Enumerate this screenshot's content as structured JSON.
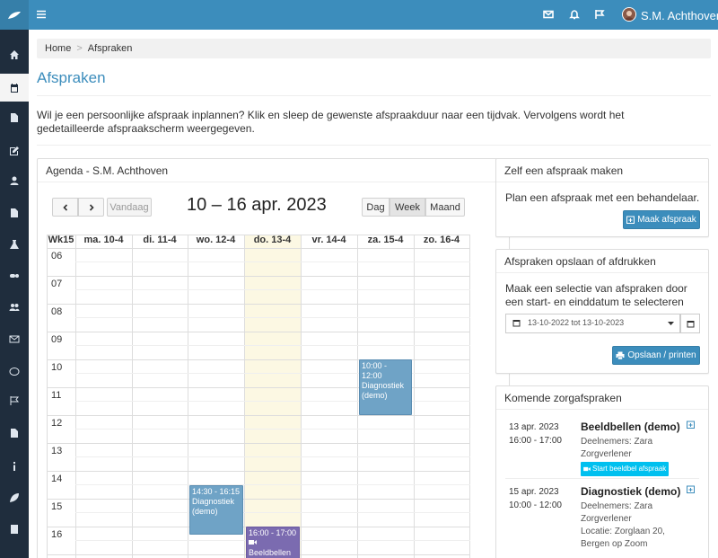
{
  "header": {
    "user_name": "S.M. Achthoven"
  },
  "sidebar": {
    "items": [
      "home-icon",
      "calendar-icon",
      "file-icon",
      "edit-icon",
      "user-icon",
      "document-icon",
      "flask-icon",
      "pills-icon",
      "users-icon",
      "envelope-icon",
      "comment-icon",
      "flag-icon",
      "file-icon",
      "info-icon",
      "leaf-icon",
      "book-icon"
    ]
  },
  "breadcrumb": {
    "home": "Home",
    "current": "Afspraken"
  },
  "page": {
    "title": "Afspraken",
    "intro": "Wil je een persoonlijke afspraak inplannen? Klik en sleep de gewenste afspraakduur naar een tijdvak. Vervolgens wordt het gedetailleerde afspraakscherm weergegeven."
  },
  "agenda": {
    "title": "Agenda - S.M. Achthoven",
    "today_label": "Vandaag",
    "range_title": "10 – 16 apr. 2023",
    "views": [
      "Dag",
      "Week",
      "Maand"
    ],
    "week_label": "Wk15",
    "days": [
      "ma. 10-4",
      "di. 11-4",
      "wo. 12-4",
      "do. 13-4",
      "vr. 14-4",
      "za. 15-4",
      "zo. 16-4"
    ],
    "hours": [
      "06",
      "07",
      "08",
      "09",
      "10",
      "11",
      "12",
      "13",
      "14",
      "15",
      "16"
    ],
    "events": [
      {
        "time": "10:00 - 12:00",
        "title": "Diagnostiek (demo)"
      },
      {
        "time": "14:30 - 16:15",
        "title": "Diagnostiek (demo)"
      },
      {
        "time": "16:00 - 17:00",
        "title": "Beeldbellen"
      }
    ]
  },
  "panel_new": {
    "title": "Zelf een afspraak maken",
    "text": "Plan een afspraak met een behandelaar.",
    "button": "Maak afspraak"
  },
  "panel_save": {
    "title": "Afspraken opslaan of afdrukken",
    "text": "Maak een selectie van afspraken door een start- en einddatum te selecteren",
    "date_range": "13-10-2022 tot 13-10-2023",
    "button": "Opslaan / printen"
  },
  "panel_upcoming": {
    "title": "Komende zorgafspraken",
    "appointments": [
      {
        "date": "13 apr. 2023",
        "time": "16:00 - 17:00",
        "name": "Beeldbellen (demo)",
        "participants_label": "Deelnemers: Zara Zorgverlener",
        "badge": "Start beeldbel afspraak"
      },
      {
        "date": "15 apr. 2023",
        "time": "10:00 - 12:00",
        "name": "Diagnostiek (demo)",
        "participants_label": "Deelnemers: Zara Zorgverlener",
        "location": "Locatie: Zorglaan 20, Bergen op Zoom"
      }
    ]
  },
  "colors": {
    "header": "#3c8dbc",
    "sidebar": "#1f2d3d",
    "today": "#fcf8e3",
    "event": "#6fa3c6",
    "event_alt": "#7b6bb0",
    "badge": "#00c0ef"
  }
}
